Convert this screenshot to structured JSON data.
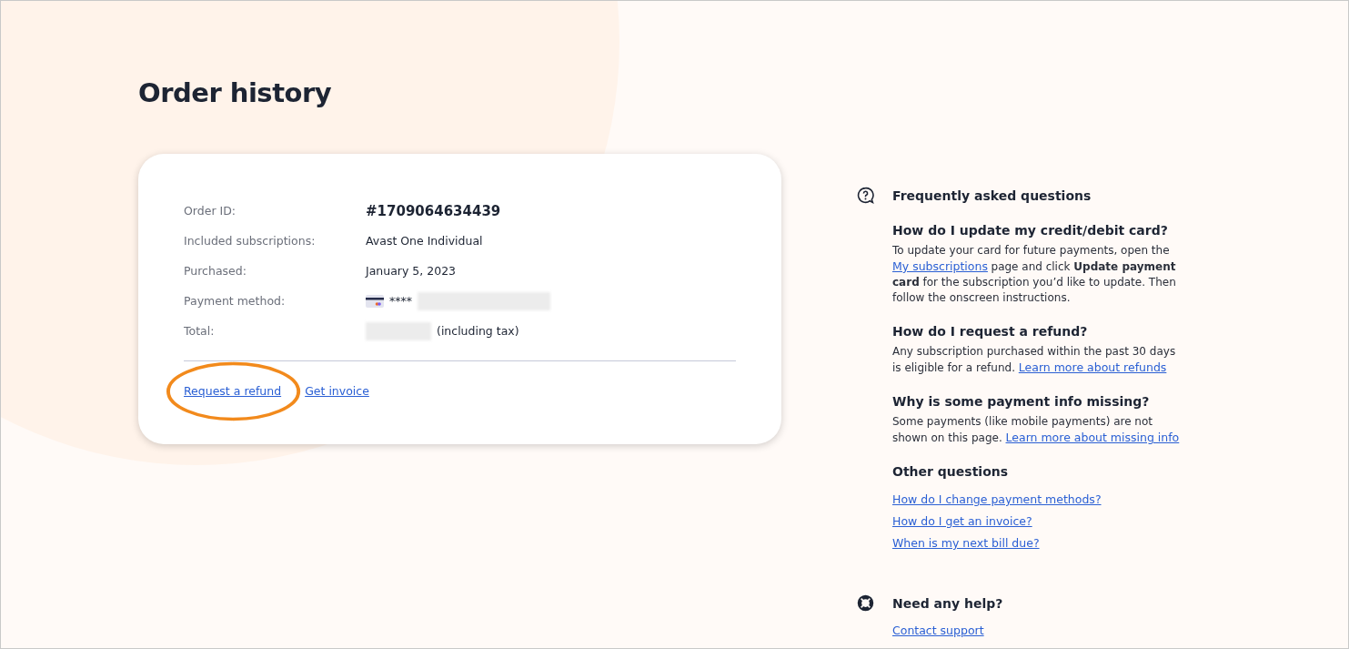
{
  "page_title": "Order history",
  "order": {
    "fields": [
      {
        "label": "Order ID:",
        "kind": "id",
        "value": "#1709064634439"
      },
      {
        "label": "Included subscriptions:",
        "kind": "text",
        "value": "Avast One Individual"
      },
      {
        "label": "Purchased:",
        "kind": "text",
        "value": "January 5, 2023"
      },
      {
        "label": "Payment method:",
        "kind": "card",
        "value": "****"
      },
      {
        "label": "Total:",
        "kind": "total",
        "value": "(including tax)"
      }
    ],
    "links": [
      {
        "label": "Request a refund",
        "highlighted": true
      },
      {
        "label": "Get invoice",
        "highlighted": false
      }
    ]
  },
  "faq": {
    "title": "Frequently asked questions",
    "items": [
      {
        "question": "How do I update my credit/debit card?",
        "before": "To update your card for future payments, open the",
        "link": "My subscriptions",
        "after": "page and click **Update payment card** for the subscription you’d like to update. Then follow the onscreen instructions."
      },
      {
        "question": "How do I request a refund?",
        "before": "Any subscription purchased within the past 30 days is eligible for a refund.",
        "link": "Learn more about refunds"
      },
      {
        "question": "Why is some payment info missing?",
        "before": "Some payments (like mobile payments) are not shown on this page.",
        "link": "Learn more about missing info"
      }
    ],
    "other_title": "Other questions",
    "other_links": [
      "How do I change payment methods?",
      "How do I get an invoice?",
      "When is my next bill due?"
    ]
  },
  "help": {
    "title": "Need any help?",
    "link": "Contact support"
  }
}
